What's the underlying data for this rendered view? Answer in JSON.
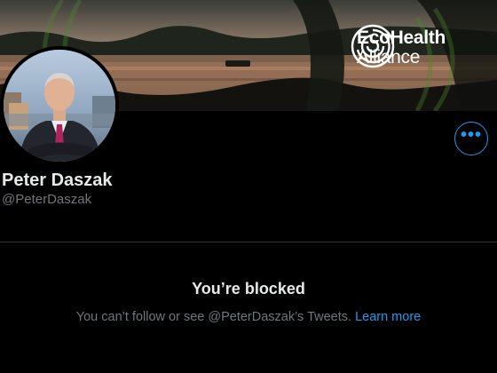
{
  "banner": {
    "logo_line1": "EcoHealth",
    "logo_line2": "Alliance"
  },
  "profile": {
    "name": "Peter Daszak",
    "handle": "@PeterDaszak"
  },
  "more_button": {
    "label": "•••"
  },
  "blocked": {
    "title": "You’re blocked",
    "message": "You can’t follow or see @PeterDaszak’s Tweets.",
    "learn_more": "Learn more"
  },
  "colors": {
    "accent": "#1d9bf0",
    "background": "#000000",
    "secondary_text": "#71767b"
  },
  "icons": [
    "ecohealth-logo-icon",
    "more-options-icon"
  ]
}
